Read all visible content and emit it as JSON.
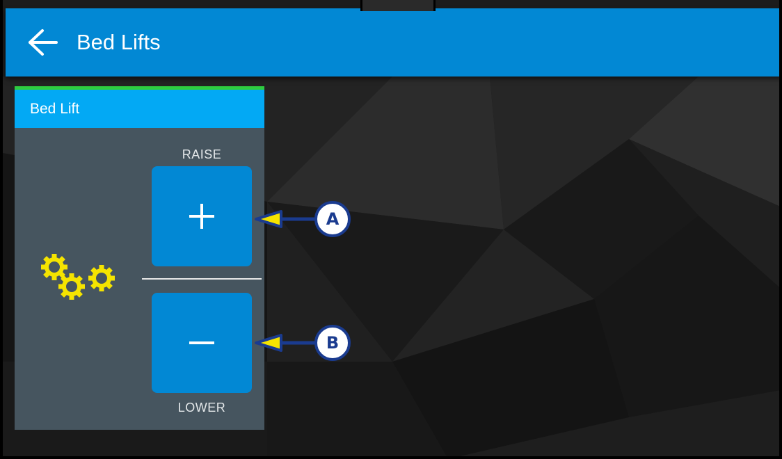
{
  "appbar": {
    "title": "Bed Lifts",
    "back_icon": "arrow-left-icon",
    "color": "#0288d4"
  },
  "card": {
    "header": "Bed Lift",
    "header_color": "#03a9f4",
    "accent_color": "#2ecc40",
    "icon": "gears-icon",
    "icon_color": "#f5e400",
    "raise_label": "RAISE",
    "lower_label": "LOWER",
    "raise_icon": "plus-icon",
    "lower_icon": "minus-icon"
  },
  "callouts": [
    {
      "letter": "A",
      "target": "raise-button"
    },
    {
      "letter": "B",
      "target": "lower-button"
    }
  ],
  "callout_colors": {
    "arrow_fill": "#f5e400",
    "arrow_stroke": "#1a3b8f"
  }
}
